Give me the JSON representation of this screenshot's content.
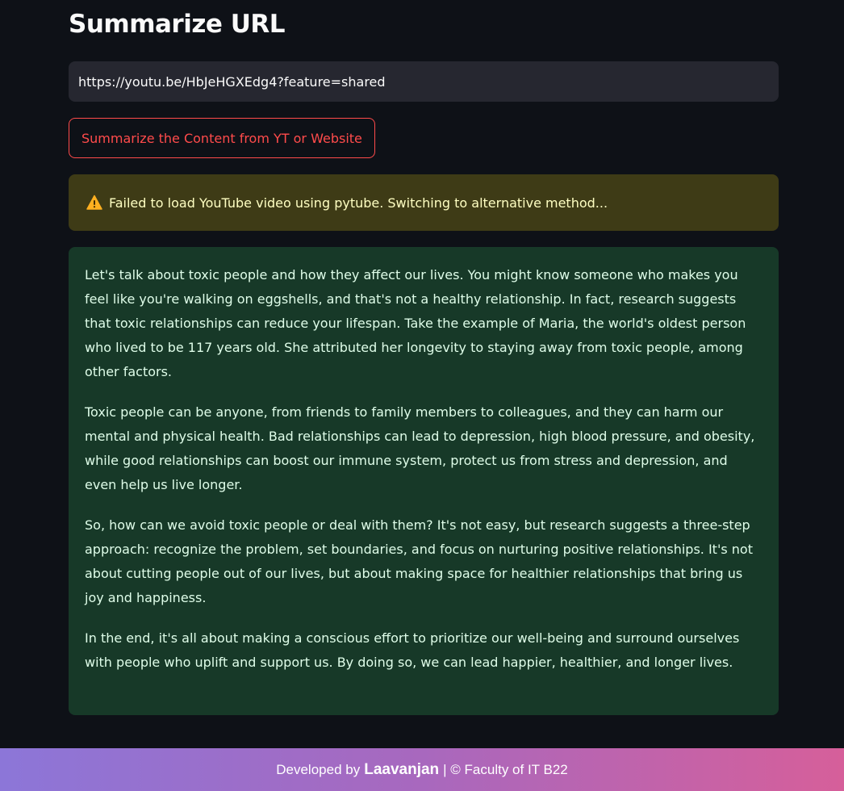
{
  "page": {
    "title": "Summarize URL"
  },
  "url_input": {
    "value": "https://youtu.be/HbJeHGXEdg4?feature=shared"
  },
  "action_button": {
    "label": "Summarize the Content from YT or Website"
  },
  "warning": {
    "icon": "warning-icon",
    "text": "Failed to load YouTube video using pytube. Switching to alternative method..."
  },
  "summary": {
    "paragraphs": [
      "Let's talk about toxic people and how they affect our lives. You might know someone who makes you feel like you're walking on eggshells, and that's not a healthy relationship. In fact, research suggests that toxic relationships can reduce your lifespan. Take the example of Maria, the world's oldest person who lived to be 117 years old. She attributed her longevity to staying away from toxic people, among other factors.",
      "Toxic people can be anyone, from friends to family members to colleagues, and they can harm our mental and physical health. Bad relationships can lead to depression, high blood pressure, and obesity, while good relationships can boost our immune system, protect us from stress and depression, and even help us live longer.",
      "So, how can we avoid toxic people or deal with them? It's not easy, but research suggests a three-step approach: recognize the problem, set boundaries, and focus on nurturing positive relationships. It's not about cutting people out of our lives, but about making space for healthier relationships that bring us joy and happiness.",
      "In the end, it's all about making a conscious effort to prioritize our well-being and surround ourselves with people who uplift and support us. By doing so, we can lead happier, healthier, and longer lives."
    ]
  },
  "footer": {
    "prefix": "Developed by",
    "author": "Laavanjan",
    "suffix": "| © Faculty of IT B22"
  },
  "colors": {
    "background": "#0e1117",
    "accent": "#ff4b4b",
    "warning_bg": "#3e3b16",
    "warning_text": "#ffffc2",
    "success_bg": "#173928",
    "success_text": "#dffde9",
    "footer_gradient_start": "#8c76d8",
    "footer_gradient_end": "#d65f9a"
  }
}
